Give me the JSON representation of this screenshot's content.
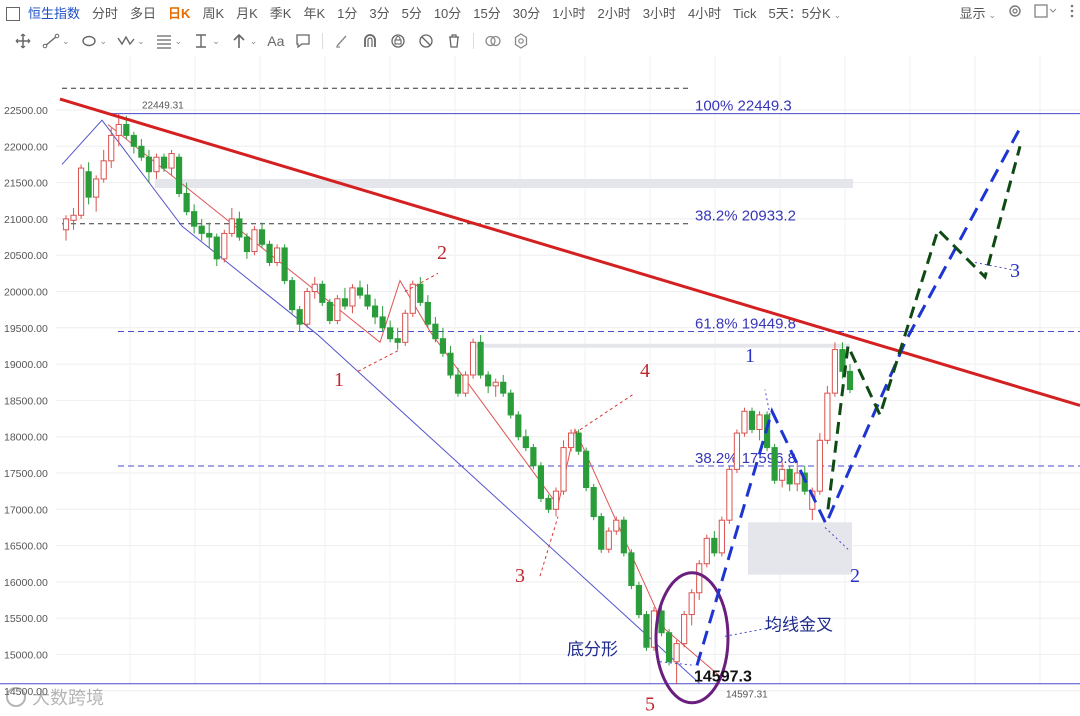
{
  "toolbar": {
    "index_name": "恒生指数",
    "periods": [
      "分时",
      "多日",
      "日K",
      "周K",
      "月K",
      "季K",
      "年K",
      "1分",
      "3分",
      "5分",
      "10分",
      "15分",
      "30分",
      "1小时",
      "2小时",
      "3小时",
      "4小时",
      "Tick"
    ],
    "active_period": "日K",
    "multi_period": "5天：5分K",
    "display_label": "显示"
  },
  "tools": [
    "crosshair-icon",
    "line-tool-icon",
    "shape-tool-icon",
    "wave-tool-icon",
    "fib-tool-icon",
    "measure-tool-icon",
    "arrow-tool-icon",
    "text-tool-icon",
    "comment-tool-icon",
    "pen-icon",
    "magnet-icon",
    "lock-icon",
    "erase-icon",
    "visibility-icon",
    "settings-icon"
  ],
  "tools_text_label": "Aa",
  "chart_data": {
    "type": "candlestick",
    "title": "恒生指数 日K",
    "y_ticks": [
      22500,
      22000,
      21500,
      21000,
      20500,
      20000,
      19500,
      19000,
      18500,
      18000,
      17500,
      17000,
      16500,
      16000,
      15500,
      15000,
      14500
    ],
    "y_tick_labels": [
      "22500.00",
      "22000.00",
      "21500.00",
      "21000.00",
      "20500.00",
      "20000.00",
      "19500.00",
      "19000.00",
      "18500.00",
      "18000.00",
      "17500.00",
      "17000.00",
      "16500.00",
      "16000.00",
      "15500.00",
      "15000.00",
      "14500.00"
    ],
    "ylim": [
      14450,
      22800
    ],
    "high_marker": "22449.31",
    "low_marker": "14597.31",
    "low_label": "14597.3",
    "fib_levels": [
      {
        "label": "100% 22449.3",
        "value": 22449.3
      },
      {
        "label": "38.2% 20933.2",
        "value": 20933.2
      },
      {
        "label": "61.8% 19449.8",
        "value": 19449.8
      },
      {
        "label": "38.2% 17596.8",
        "value": 17596.8
      }
    ],
    "wave_labels": [
      "1",
      "2",
      "3",
      "4",
      "5"
    ],
    "projection_labels": [
      "1",
      "2",
      "3"
    ],
    "annotations": {
      "bottom_fractal": "底分形",
      "golden_cross": "均线金叉"
    },
    "candles": [
      {
        "o": 20850,
        "h": 21050,
        "l": 20700,
        "c": 21000
      },
      {
        "o": 20980,
        "h": 21150,
        "l": 20850,
        "c": 21050
      },
      {
        "o": 21050,
        "h": 21750,
        "l": 21000,
        "c": 21700
      },
      {
        "o": 21650,
        "h": 21780,
        "l": 21200,
        "c": 21300
      },
      {
        "o": 21300,
        "h": 21600,
        "l": 21100,
        "c": 21550
      },
      {
        "o": 21550,
        "h": 21950,
        "l": 21500,
        "c": 21800
      },
      {
        "o": 21800,
        "h": 22250,
        "l": 21700,
        "c": 22150
      },
      {
        "o": 22150,
        "h": 22449,
        "l": 22000,
        "c": 22300
      },
      {
        "o": 22300,
        "h": 22420,
        "l": 22100,
        "c": 22150
      },
      {
        "o": 22150,
        "h": 22200,
        "l": 21900,
        "c": 22000
      },
      {
        "o": 22000,
        "h": 22100,
        "l": 21800,
        "c": 21850
      },
      {
        "o": 21850,
        "h": 21950,
        "l": 21500,
        "c": 21650
      },
      {
        "o": 21650,
        "h": 21900,
        "l": 21550,
        "c": 21850
      },
      {
        "o": 21850,
        "h": 21900,
        "l": 21650,
        "c": 21700
      },
      {
        "o": 21700,
        "h": 21950,
        "l": 21600,
        "c": 21900
      },
      {
        "o": 21850,
        "h": 21900,
        "l": 21300,
        "c": 21350
      },
      {
        "o": 21350,
        "h": 21500,
        "l": 21050,
        "c": 21100
      },
      {
        "o": 21100,
        "h": 21200,
        "l": 20800,
        "c": 20900
      },
      {
        "o": 20900,
        "h": 21000,
        "l": 20700,
        "c": 20800
      },
      {
        "o": 20800,
        "h": 20950,
        "l": 20600,
        "c": 20750
      },
      {
        "o": 20750,
        "h": 20800,
        "l": 20350,
        "c": 20450
      },
      {
        "o": 20450,
        "h": 20850,
        "l": 20400,
        "c": 20800
      },
      {
        "o": 20800,
        "h": 21150,
        "l": 20750,
        "c": 21000
      },
      {
        "o": 21000,
        "h": 21100,
        "l": 20700,
        "c": 20750
      },
      {
        "o": 20750,
        "h": 20800,
        "l": 20450,
        "c": 20550
      },
      {
        "o": 20550,
        "h": 20900,
        "l": 20500,
        "c": 20850
      },
      {
        "o": 20850,
        "h": 20950,
        "l": 20600,
        "c": 20650
      },
      {
        "o": 20650,
        "h": 20700,
        "l": 20350,
        "c": 20400
      },
      {
        "o": 20400,
        "h": 20650,
        "l": 20350,
        "c": 20600
      },
      {
        "o": 20600,
        "h": 20650,
        "l": 20100,
        "c": 20150
      },
      {
        "o": 20150,
        "h": 20200,
        "l": 19700,
        "c": 19750
      },
      {
        "o": 19750,
        "h": 19800,
        "l": 19450,
        "c": 19550
      },
      {
        "o": 19550,
        "h": 20050,
        "l": 19500,
        "c": 20000
      },
      {
        "o": 20000,
        "h": 20200,
        "l": 19900,
        "c": 20100
      },
      {
        "o": 20100,
        "h": 20150,
        "l": 19800,
        "c": 19850
      },
      {
        "o": 19850,
        "h": 19900,
        "l": 19550,
        "c": 19600
      },
      {
        "o": 19600,
        "h": 19950,
        "l": 19550,
        "c": 19900
      },
      {
        "o": 19900,
        "h": 20050,
        "l": 19750,
        "c": 19800
      },
      {
        "o": 19800,
        "h": 20100,
        "l": 19700,
        "c": 20050
      },
      {
        "o": 20050,
        "h": 20150,
        "l": 19900,
        "c": 19950
      },
      {
        "o": 19950,
        "h": 20100,
        "l": 19750,
        "c": 19800
      },
      {
        "o": 19800,
        "h": 19900,
        "l": 19550,
        "c": 19650
      },
      {
        "o": 19650,
        "h": 19800,
        "l": 19450,
        "c": 19500
      },
      {
        "o": 19500,
        "h": 19600,
        "l": 19300,
        "c": 19350
      },
      {
        "o": 19350,
        "h": 19500,
        "l": 19200,
        "c": 19300
      },
      {
        "o": 19300,
        "h": 19750,
        "l": 19250,
        "c": 19700
      },
      {
        "o": 19700,
        "h": 20150,
        "l": 19650,
        "c": 20100
      },
      {
        "o": 20100,
        "h": 20200,
        "l": 19800,
        "c": 19850
      },
      {
        "o": 19850,
        "h": 19950,
        "l": 19500,
        "c": 19550
      },
      {
        "o": 19550,
        "h": 19650,
        "l": 19300,
        "c": 19350
      },
      {
        "o": 19350,
        "h": 19500,
        "l": 19100,
        "c": 19150
      },
      {
        "o": 19150,
        "h": 19250,
        "l": 18800,
        "c": 18850
      },
      {
        "o": 18850,
        "h": 18950,
        "l": 18550,
        "c": 18600
      },
      {
        "o": 18600,
        "h": 18900,
        "l": 18550,
        "c": 18850
      },
      {
        "o": 18850,
        "h": 19350,
        "l": 18800,
        "c": 19300
      },
      {
        "o": 19300,
        "h": 19400,
        "l": 18800,
        "c": 18850
      },
      {
        "o": 18850,
        "h": 18900,
        "l": 18600,
        "c": 18700
      },
      {
        "o": 18700,
        "h": 18800,
        "l": 18550,
        "c": 18750
      },
      {
        "o": 18750,
        "h": 18850,
        "l": 18550,
        "c": 18600
      },
      {
        "o": 18600,
        "h": 18650,
        "l": 18250,
        "c": 18300
      },
      {
        "o": 18300,
        "h": 18350,
        "l": 17950,
        "c": 18000
      },
      {
        "o": 18000,
        "h": 18100,
        "l": 17800,
        "c": 17850
      },
      {
        "o": 17850,
        "h": 17900,
        "l": 17550,
        "c": 17600
      },
      {
        "o": 17600,
        "h": 17650,
        "l": 17100,
        "c": 17150
      },
      {
        "o": 17150,
        "h": 17200,
        "l": 16950,
        "c": 17000
      },
      {
        "o": 17000,
        "h": 17300,
        "l": 16900,
        "c": 17250
      },
      {
        "o": 17250,
        "h": 17950,
        "l": 17200,
        "c": 17850
      },
      {
        "o": 17850,
        "h": 18100,
        "l": 17800,
        "c": 18050
      },
      {
        "o": 18050,
        "h": 18100,
        "l": 17750,
        "c": 17800
      },
      {
        "o": 17800,
        "h": 17850,
        "l": 17250,
        "c": 17300
      },
      {
        "o": 17300,
        "h": 17350,
        "l": 16850,
        "c": 16900
      },
      {
        "o": 16900,
        "h": 16950,
        "l": 16400,
        "c": 16450
      },
      {
        "o": 16450,
        "h": 16750,
        "l": 16400,
        "c": 16700
      },
      {
        "o": 16700,
        "h": 16900,
        "l": 16650,
        "c": 16850
      },
      {
        "o": 16850,
        "h": 16900,
        "l": 16350,
        "c": 16400
      },
      {
        "o": 16400,
        "h": 16450,
        "l": 15900,
        "c": 15950
      },
      {
        "o": 15950,
        "h": 16000,
        "l": 15500,
        "c": 15550
      },
      {
        "o": 15550,
        "h": 15600,
        "l": 15050,
        "c": 15100
      },
      {
        "o": 15100,
        "h": 15650,
        "l": 15050,
        "c": 15600
      },
      {
        "o": 15600,
        "h": 15700,
        "l": 15250,
        "c": 15300
      },
      {
        "o": 15300,
        "h": 15350,
        "l": 14850,
        "c": 14900
      },
      {
        "o": 14900,
        "h": 15200,
        "l": 14597,
        "c": 15150
      },
      {
        "o": 15150,
        "h": 15600,
        "l": 15100,
        "c": 15550
      },
      {
        "o": 15550,
        "h": 15900,
        "l": 15400,
        "c": 15850
      },
      {
        "o": 15850,
        "h": 16300,
        "l": 15750,
        "c": 16250
      },
      {
        "o": 16250,
        "h": 16650,
        "l": 16200,
        "c": 16600
      },
      {
        "o": 16600,
        "h": 16700,
        "l": 16350,
        "c": 16400
      },
      {
        "o": 16400,
        "h": 16900,
        "l": 16350,
        "c": 16850
      },
      {
        "o": 16850,
        "h": 17600,
        "l": 16800,
        "c": 17550
      },
      {
        "o": 17550,
        "h": 18100,
        "l": 17500,
        "c": 18050
      },
      {
        "o": 18050,
        "h": 18400,
        "l": 18000,
        "c": 18350
      },
      {
        "o": 18350,
        "h": 18400,
        "l": 18050,
        "c": 18100
      },
      {
        "o": 18100,
        "h": 18350,
        "l": 17950,
        "c": 18300
      },
      {
        "o": 18300,
        "h": 18350,
        "l": 17800,
        "c": 17850
      },
      {
        "o": 17850,
        "h": 17900,
        "l": 17350,
        "c": 17400
      },
      {
        "o": 17400,
        "h": 17650,
        "l": 17300,
        "c": 17550
      },
      {
        "o": 17550,
        "h": 17600,
        "l": 17250,
        "c": 17350
      },
      {
        "o": 17350,
        "h": 17650,
        "l": 17250,
        "c": 17500
      },
      {
        "o": 17500,
        "h": 17600,
        "l": 17200,
        "c": 17250
      },
      {
        "o": 17000,
        "h": 17300,
        "l": 16850,
        "c": 17250
      },
      {
        "o": 17250,
        "h": 18050,
        "l": 17200,
        "c": 17950
      },
      {
        "o": 17950,
        "h": 18700,
        "l": 17900,
        "c": 18600
      },
      {
        "o": 18600,
        "h": 19300,
        "l": 18550,
        "c": 19200
      },
      {
        "o": 19200,
        "h": 19300,
        "l": 18800,
        "c": 18900
      },
      {
        "o": 18900,
        "h": 19000,
        "l": 18600,
        "c": 18650
      }
    ],
    "colors": {
      "up": "#d9534f",
      "down": "#2a9d3a",
      "resistance": "#d42020",
      "fib": "#3636b8",
      "projection_blue": "#1d35d1",
      "projection_green": "#0e4a12",
      "ellipse": "#6a1f7e"
    }
  },
  "watermark": "大数跨境"
}
